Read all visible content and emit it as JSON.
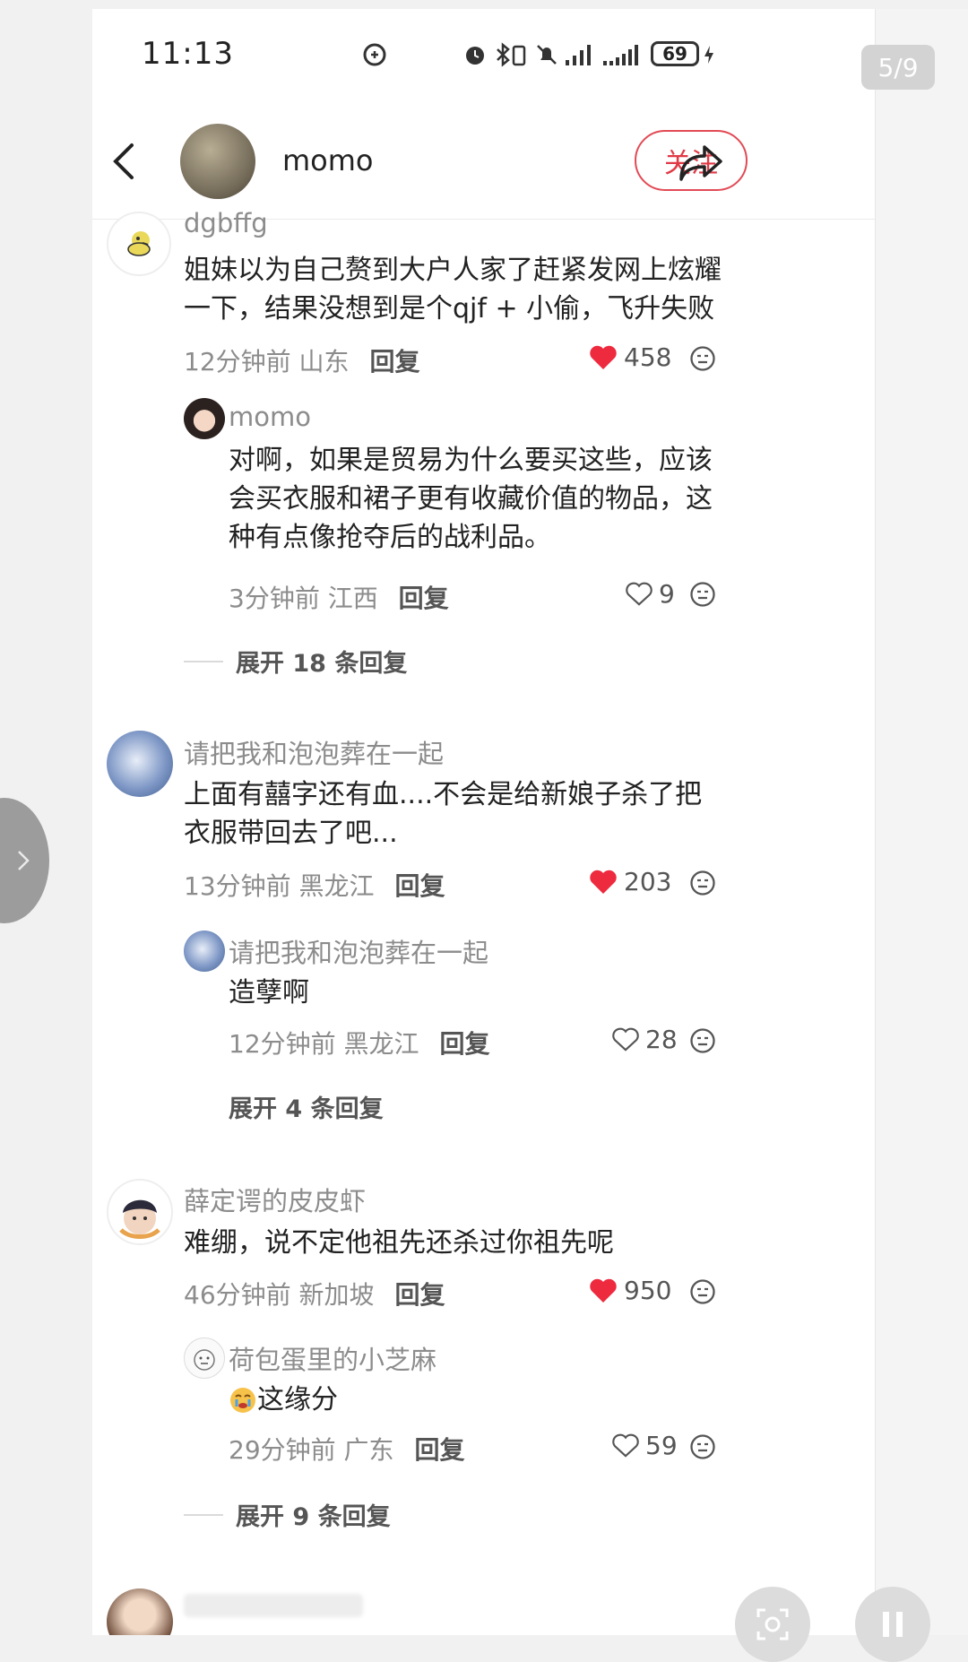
{
  "status_bar": {
    "time": "11:13",
    "battery": "69"
  },
  "header": {
    "author": "momo",
    "follow_label": "关注"
  },
  "pager": "5/9",
  "comments": [
    {
      "name": "dgbffg",
      "text": "姐妹以为自己赘到大户人家了赶紧发网上炫耀一下，结果没想到是个qjf + 小偷，飞升失败",
      "time": "12分钟前",
      "location": "山东",
      "reply": "回复",
      "likes": "458",
      "sub": {
        "name": "momo",
        "text": "对啊，如果是贸易为什么要买这些，应该会买衣服和裙子更有收藏价值的物品，这种有点像抢夺后的战利品。",
        "time": "3分钟前",
        "location": "江西",
        "reply": "回复",
        "likes": "9"
      },
      "expand": "展开 18 条回复"
    },
    {
      "name": "请把我和泡泡葬在一起",
      "text": "上面有囍字还有血....不会是给新娘子杀了把衣服带回去了吧...",
      "time": "13分钟前",
      "location": "黑龙江",
      "reply": "回复",
      "likes": "203",
      "sub": {
        "name": "请把我和泡泡葬在一起",
        "text": "造孽啊",
        "time": "12分钟前",
        "location": "黑龙江",
        "reply": "回复",
        "likes": "28"
      },
      "expand": "展开 4 条回复"
    },
    {
      "name": "薛定谔的皮皮虾",
      "text": "难绷，说不定他祖先还杀过你祖先呢",
      "time": "46分钟前",
      "location": "新加坡",
      "reply": "回复",
      "likes": "950",
      "sub": {
        "name": "荷包蛋里的小芝麻",
        "text": "这缘分",
        "time": "29分钟前",
        "location": "广东",
        "reply": "回复",
        "likes": "59"
      },
      "expand": "展开 9 条回复"
    }
  ],
  "colors": {
    "like_red": "#ee2a3f",
    "follow_red": "#e24a55"
  }
}
